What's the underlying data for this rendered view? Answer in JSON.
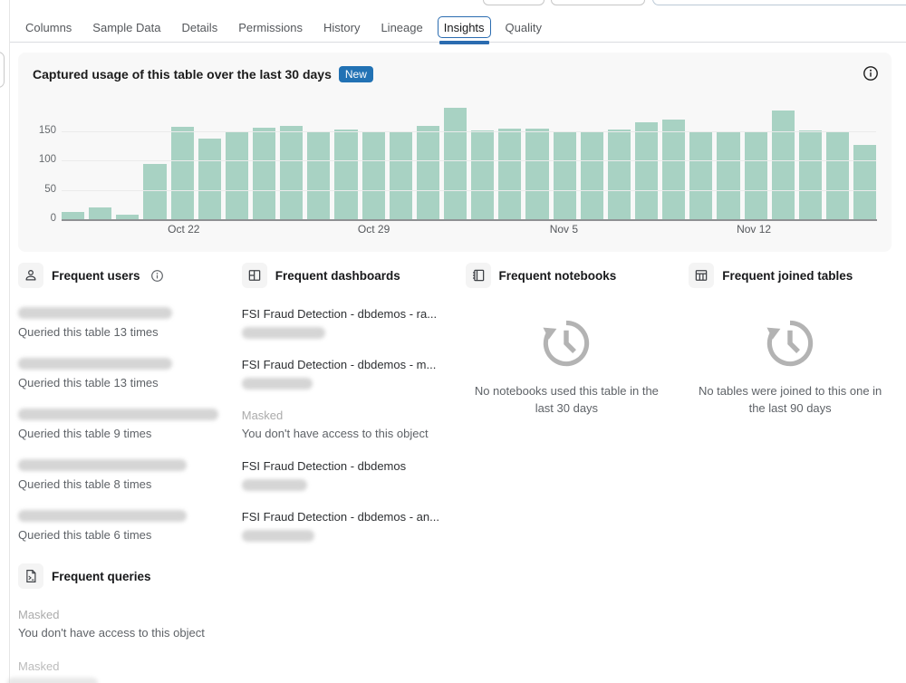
{
  "tabs": {
    "items": [
      {
        "label": "Columns"
      },
      {
        "label": "Sample Data"
      },
      {
        "label": "Details"
      },
      {
        "label": "Permissions"
      },
      {
        "label": "History"
      },
      {
        "label": "Lineage"
      },
      {
        "label": "Insights"
      },
      {
        "label": "Quality"
      }
    ],
    "selected": "Insights"
  },
  "usage_panel": {
    "title": "Captured usage of this table over the last 30 days",
    "badge": "New"
  },
  "chart_data": {
    "type": "bar",
    "title": "Captured usage of this table over the last 30 days",
    "values": [
      12,
      20,
      8,
      95,
      157,
      137,
      148,
      156,
      160,
      149,
      153,
      149,
      149,
      160,
      190,
      152,
      155,
      154,
      149,
      148,
      153,
      166,
      170,
      149,
      148,
      149,
      185,
      151,
      149,
      127
    ],
    "x_ticks": [
      {
        "index": 4,
        "label": "Oct 22"
      },
      {
        "index": 11,
        "label": "Oct 29"
      },
      {
        "index": 18,
        "label": "Nov 5"
      },
      {
        "index": 25,
        "label": "Nov 12"
      }
    ],
    "yticks": [
      0,
      50,
      100,
      150
    ],
    "ylim": [
      0,
      200
    ],
    "bar_color": "#a8d2c3",
    "grid": true,
    "legend": false
  },
  "sections": {
    "users": {
      "title": "Frequent users",
      "items": [
        {
          "name_redacted": true,
          "note": "Queried this table 13 times"
        },
        {
          "name_redacted": true,
          "note": "Queried this table 13 times"
        },
        {
          "name_redacted": true,
          "note": "Queried this table 9 times"
        },
        {
          "name_redacted": true,
          "note": "Queried this table 8 times"
        },
        {
          "name_redacted": true,
          "note": "Queried this table 6 times"
        }
      ]
    },
    "dashboards": {
      "title": "Frequent dashboards",
      "items": [
        {
          "title": "FSI Fraud Detection - dbdemos - ra...",
          "subtitle_redacted": true
        },
        {
          "title": "FSI Fraud Detection - dbdemos - m...",
          "subtitle_redacted": true
        },
        {
          "masked_label": "Masked",
          "masked_note": "You don't have access to this object"
        },
        {
          "title": "FSI Fraud Detection - dbdemos",
          "subtitle_redacted": true
        },
        {
          "title": "FSI Fraud Detection - dbdemos - an...",
          "subtitle_redacted": true
        }
      ]
    },
    "notebooks": {
      "title": "Frequent notebooks",
      "empty_text": "No notebooks used this table in the last 30 days"
    },
    "joined_tables": {
      "title": "Frequent joined tables",
      "empty_text": "No tables were joined to this one in the last 90 days"
    },
    "queries": {
      "title": "Frequent queries",
      "items": [
        {
          "masked_label": "Masked",
          "masked_note": "You don't have access to this object"
        },
        {
          "masked_label": "Masked"
        }
      ]
    }
  },
  "colors": {
    "accent_blue": "#2272b4",
    "bar_green": "#a8d2c3",
    "panel_bg": "#f8f8f8",
    "muted_text": "#5f6368",
    "masked_text": "#ababab"
  }
}
